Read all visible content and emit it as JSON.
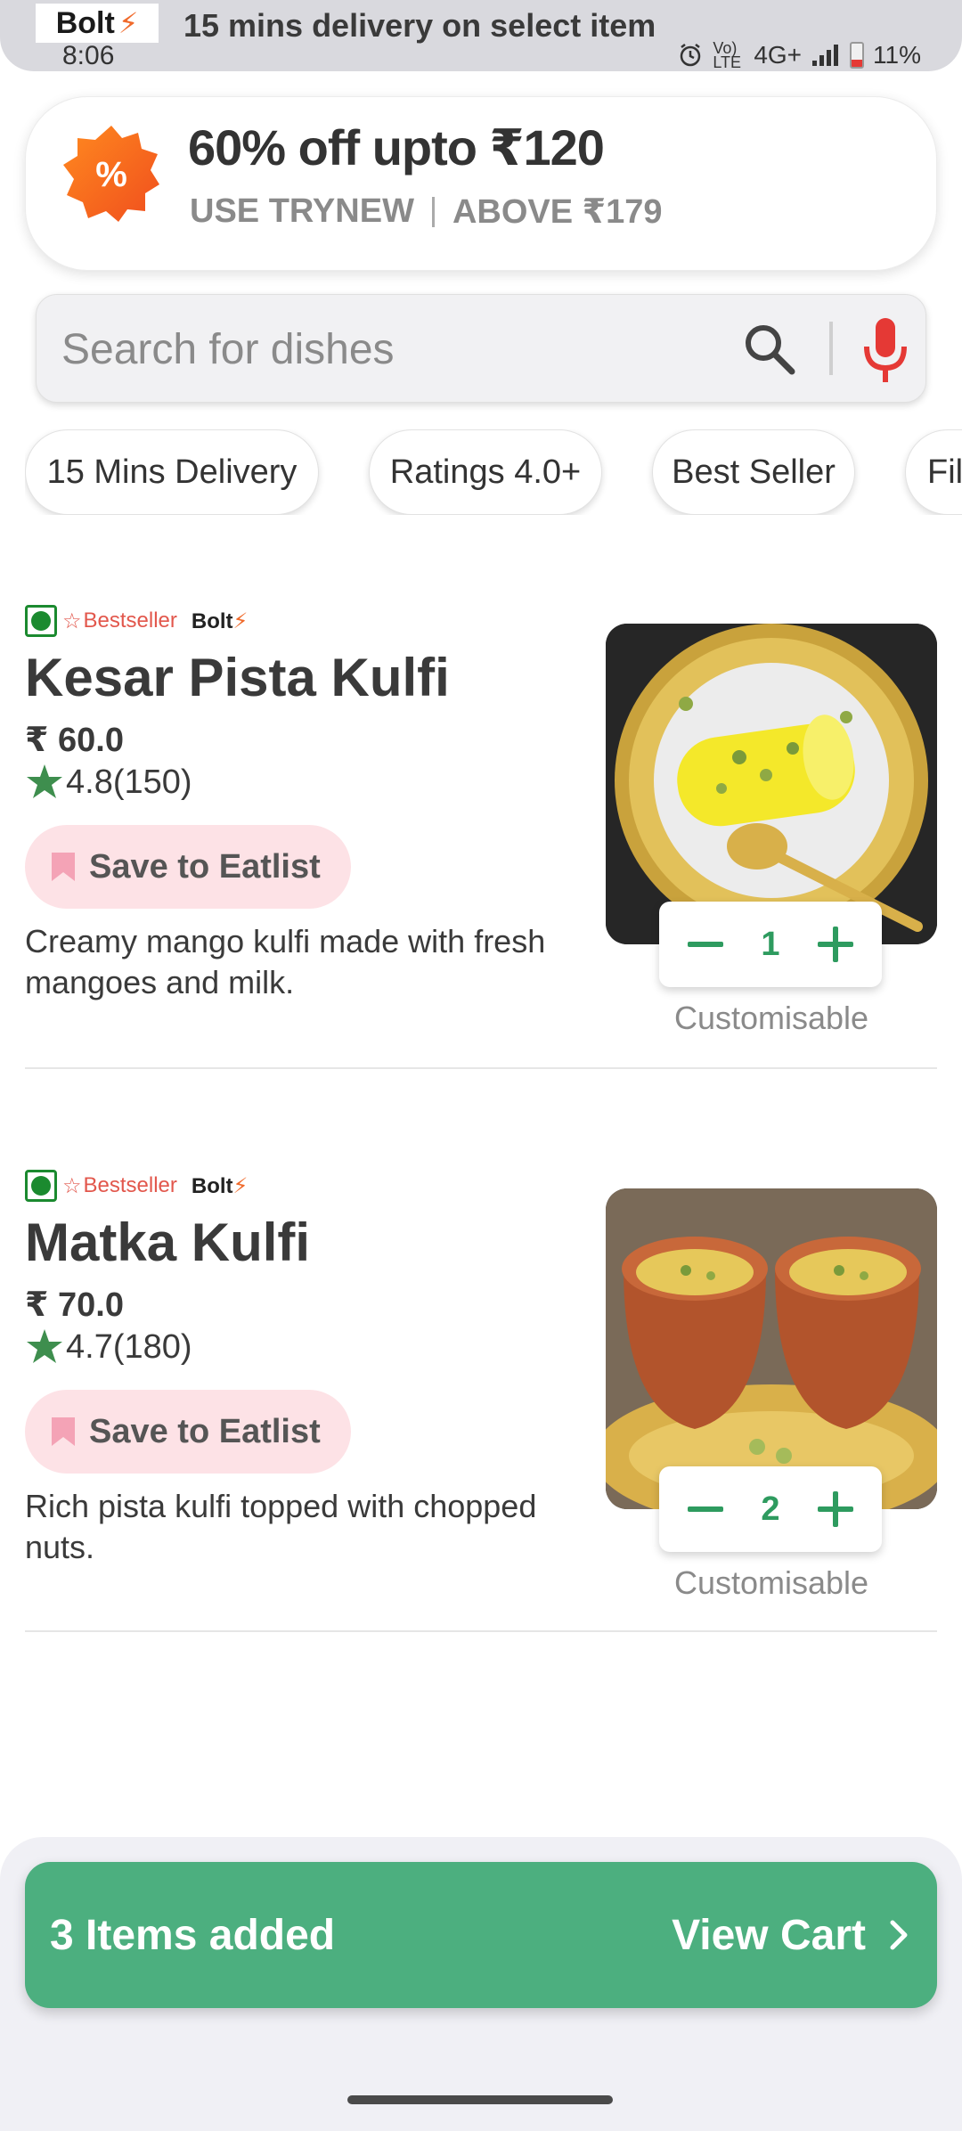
{
  "status_bar": {
    "app_logo": "Bolt",
    "notification_text": "15 mins delivery on select item",
    "time": "8:06",
    "network": "4G+",
    "volte": "Vo) LTE",
    "battery": "11%"
  },
  "offer": {
    "badge_symbol": "%",
    "title": "60% off upto ₹120",
    "code": "USE TRYNEW",
    "condition": "ABOVE ₹179",
    "badge_color": "#f26b21"
  },
  "search": {
    "placeholder": "Search for dishes",
    "value": ""
  },
  "filters": [
    {
      "label": "15 Mins Delivery"
    },
    {
      "label": "Ratings 4.0+"
    },
    {
      "label": "Best Seller"
    },
    {
      "label": "Filt"
    }
  ],
  "items": [
    {
      "tag_bestseller": "Bestseller",
      "tag_bolt": "Bolt",
      "name": "Kesar Pista Kulfi",
      "price": "₹ 60.0",
      "rating": "4.8(150)",
      "eatlist_label": "Save to Eatlist",
      "description": "Creamy mango kulfi made with fresh mangoes and milk.",
      "quantity": "1",
      "customisable_label": "Customisable"
    },
    {
      "tag_bestseller": "Bestseller",
      "tag_bolt": "Bolt",
      "name": "Matka Kulfi",
      "price": "₹ 70.0",
      "rating": "4.7(180)",
      "eatlist_label": "Save to Eatlist",
      "description": "Rich pista kulfi topped with chopped nuts.",
      "quantity": "2",
      "customisable_label": "Customisable"
    }
  ],
  "cart": {
    "items_added": "3 Items added",
    "view_cart_label": "View Cart",
    "color": "#4caf7f"
  },
  "colors": {
    "accent_green": "#2e9b5f",
    "veg_green": "#1b8a2f",
    "eatlist_bg": "#fde2e6",
    "bestseller_red": "#e2574c",
    "mic_red": "#e53935"
  }
}
